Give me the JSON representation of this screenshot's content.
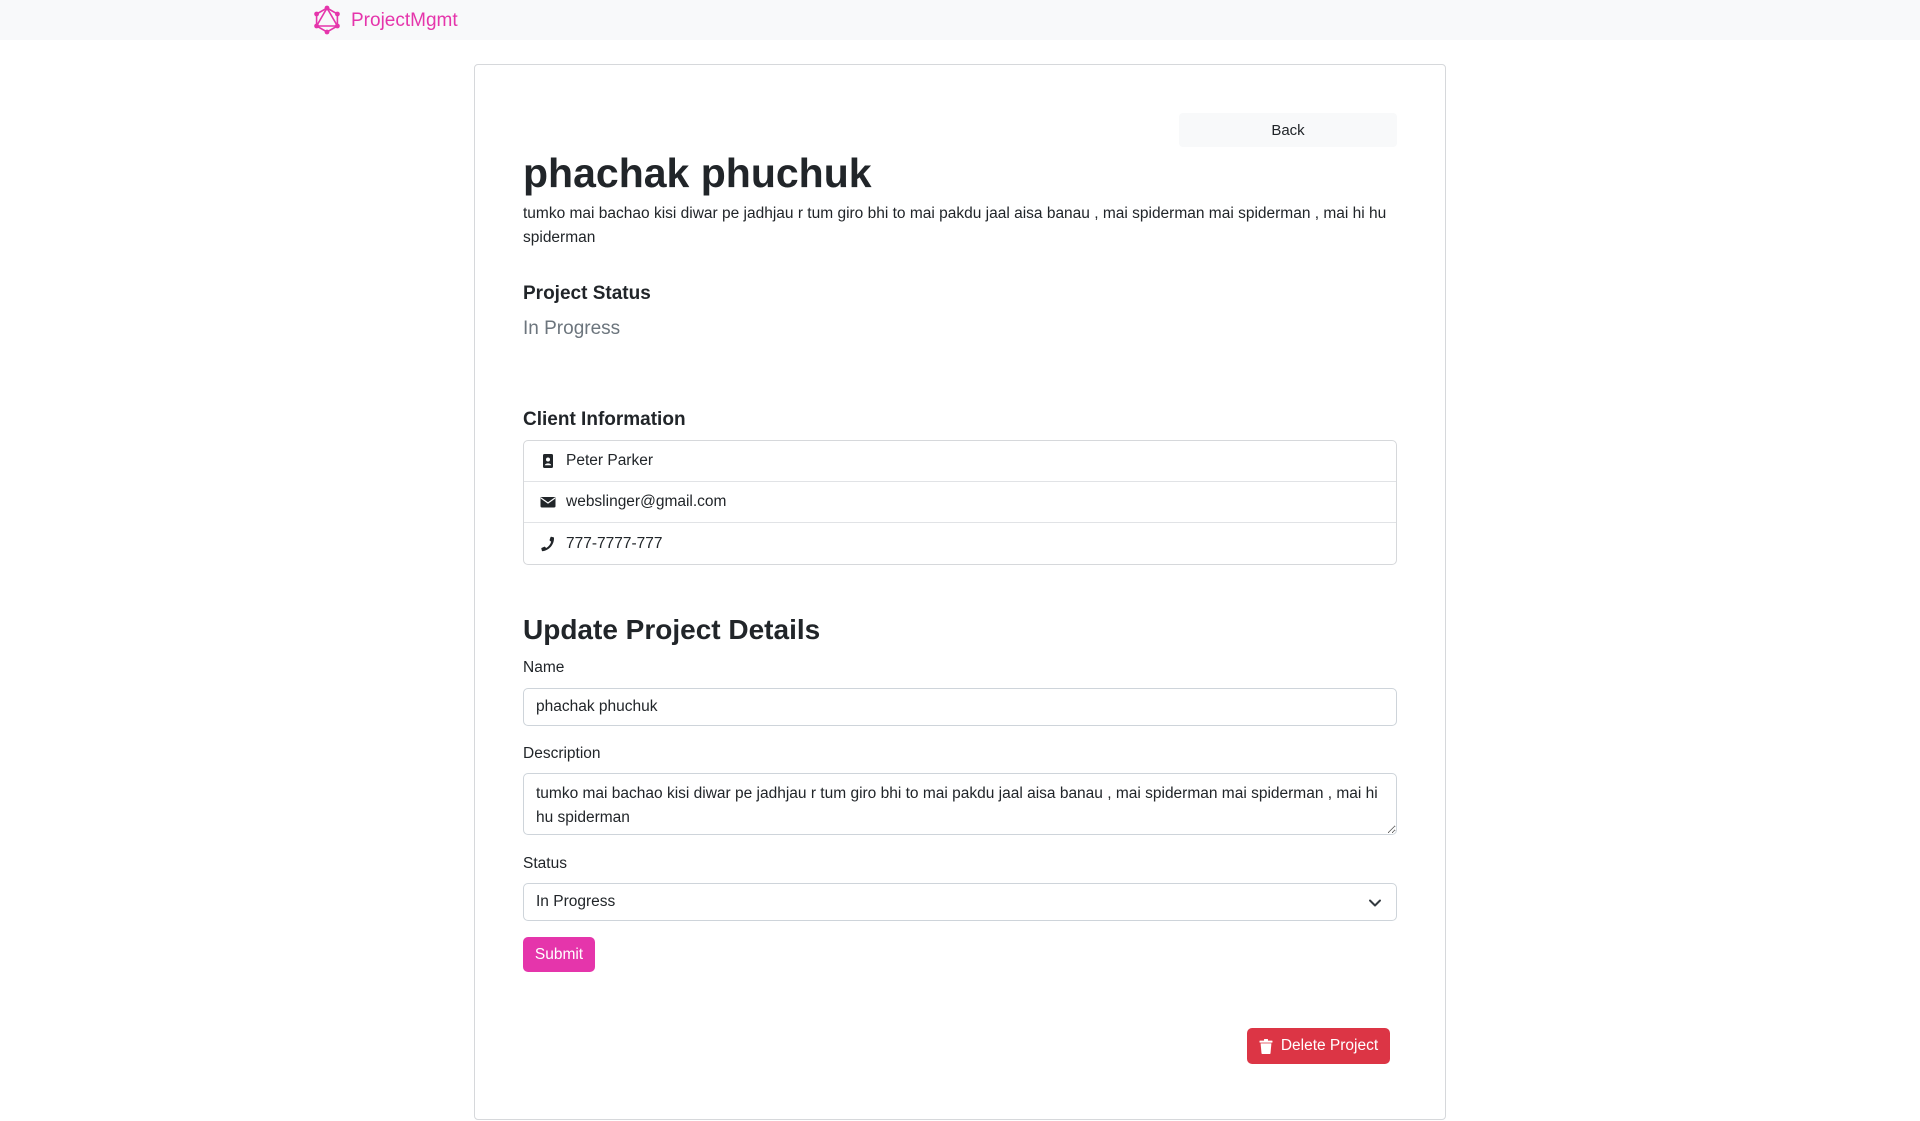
{
  "navbar": {
    "brand": "ProjectMgmt",
    "logo_icon": "graphql-logo-icon",
    "brand_color": "#e535ab"
  },
  "project": {
    "back_label": "Back",
    "name": "phachak phuchuk",
    "description": "tumko mai bachao kisi diwar pe jadhjau r tum giro bhi to mai pakdu jaal aisa banau , mai spiderman mai spiderman , mai hi hu spiderman",
    "status_heading": "Project Status",
    "status": "In Progress"
  },
  "client": {
    "heading": "Client Information",
    "name": "Peter Parker",
    "email": "webslinger@gmail.com",
    "phone": "777-7777-777",
    "icons": [
      "id-badge-icon",
      "envelope-icon",
      "phone-icon"
    ]
  },
  "form": {
    "heading": "Update Project Details",
    "name_label": "Name",
    "name_value": "phachak phuchuk",
    "description_label": "Description",
    "description_value": "tumko mai bachao kisi diwar pe jadhjau r tum giro bhi to mai pakdu jaal aisa banau , mai spiderman mai spiderman , mai hi hu spiderman",
    "status_label": "Status",
    "status_value": "In Progress",
    "submit_label": "Submit",
    "submit_color": "#e535ab"
  },
  "delete": {
    "label": "Delete Project",
    "icon": "trash-icon",
    "color": "#dc3545"
  }
}
